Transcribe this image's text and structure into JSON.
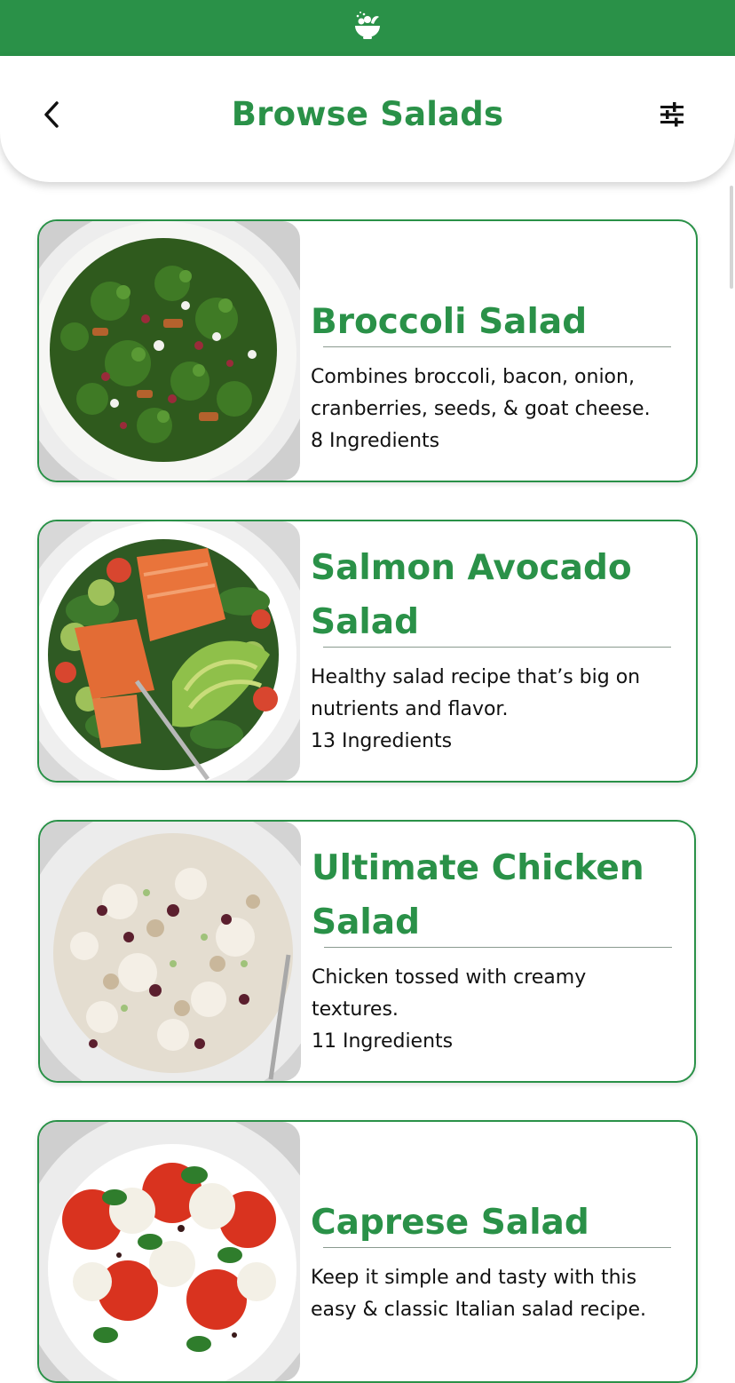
{
  "header": {
    "title": "Browse Salads"
  },
  "colors": {
    "brand_green": "#2a9148",
    "text": "#111111"
  },
  "icons": {
    "logo": "salad-bowl-icon",
    "back": "chevron-left-icon",
    "filter": "sliders-icon"
  },
  "salads": [
    {
      "title": "Broccoli Salad",
      "description": "Combines broccoli, bacon, onion, cranberries, seeds, & goat cheese.",
      "ingredients": "8 Ingredients"
    },
    {
      "title": "Salmon Avocado Salad",
      "description": "Healthy salad recipe that’s big on nutrients and flavor.",
      "ingredients": "13 Ingredients"
    },
    {
      "title": "Ultimate Chicken Salad",
      "description": "Chicken tossed with creamy textures.",
      "ingredients": "11 Ingredients"
    },
    {
      "title": "Caprese Salad",
      "description": "Keep it simple and tasty with this easy & classic Italian salad recipe.",
      "ingredients": ""
    }
  ]
}
